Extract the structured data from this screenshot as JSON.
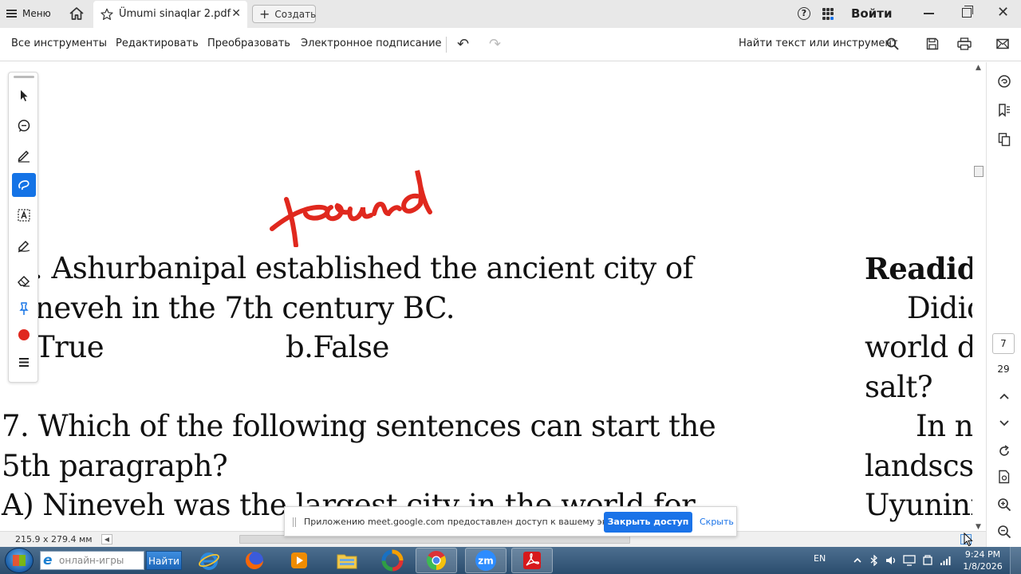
{
  "titlebar": {
    "menu_label": "Меню",
    "tab_title": "Ümumi sinaqlar 2.pdf",
    "tab_close": "✕",
    "create_label": "Создать",
    "login_label": "Войти",
    "help_glyph": "?",
    "close_glyph": "✕"
  },
  "toolbar": {
    "items": [
      "Все инструменты",
      "Редактировать",
      "Преобразовать",
      "Электронное подписание"
    ],
    "undo_glyph": "↶",
    "redo_glyph": "↷",
    "search_label": "Найти текст или инструмент"
  },
  "document": {
    "handwriting": "found",
    "q6_line1": "-. Ashurbanipal established the ancient city of",
    "q6_line2": "neveh in the 7th century BC.",
    "q6_opt_a": "True",
    "q6_opt_b": "b.False",
    "q7_line1": "7. Which of the following sentences can start the",
    "q7_line2": "5th paragraph?",
    "q7_line3": "A) Nineveh was the largest city in the world for",
    "right_heading": "Readidi",
    "right_line1": "Didid",
    "right_line2": "world d",
    "right_line3": "salt?",
    "right_line4": "In n",
    "right_line5": "landscsc",
    "right_line6": "Uyunini"
  },
  "palette": {
    "tools": [
      "select-tool",
      "comment-tool",
      "pen-tool",
      "lasso-draw-tool",
      "text-box-tool",
      "fill-sign-tool",
      "eraser-tool",
      "pin-tool",
      "color-tool",
      "more-tool"
    ],
    "active_tool": "lasso-draw-tool",
    "active_color": "#e0281e"
  },
  "right_panel": {
    "current_page": "7",
    "total_pages": "29"
  },
  "statusbar": {
    "page_size": "215.9 x 279.4 мм"
  },
  "notification": {
    "message": "Приложению meet.google.com предоставлен доступ к вашему экрану.",
    "stop_label": "Закрыть доступ",
    "hide_label": "Скрыть"
  },
  "taskbar": {
    "search_placeholder": "онлайн-игры",
    "find_label": "Найти",
    "zoom_label": "zm",
    "lang": "EN",
    "time": "9:24 PM",
    "date": "1/8/2026"
  },
  "colors": {
    "accent": "#1473e6",
    "ink": "#e0281e",
    "notif_button": "#1a73e8"
  }
}
